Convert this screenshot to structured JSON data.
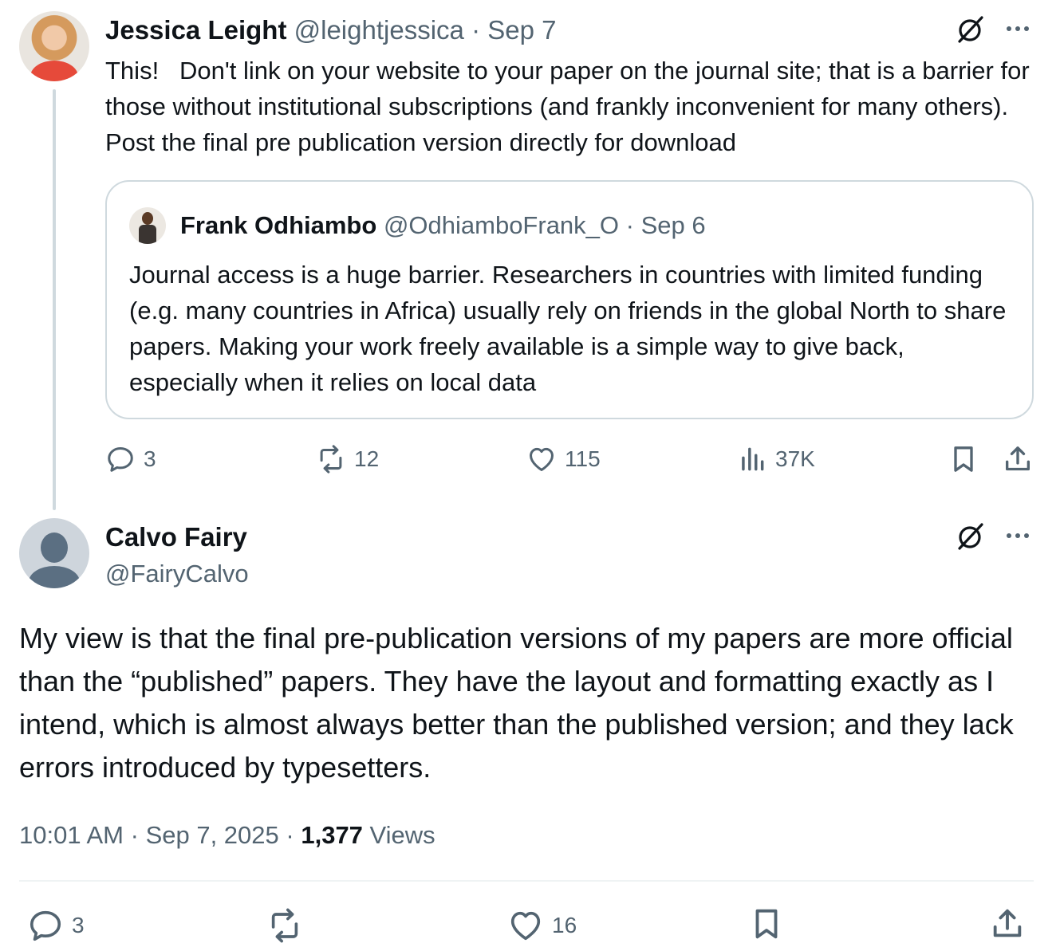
{
  "parent_tweet": {
    "author_name": "Jessica Leight",
    "author_handle": "@leightjessica",
    "separator": "·",
    "date": "Sep 7",
    "text": "This!   Don't link on your website to your paper on the journal site; that is a barrier for those without institutional subscriptions (and frankly inconvenient for many others).  Post the final pre publication version directly for download",
    "quote": {
      "author_name": "Frank Odhiambo",
      "author_handle": "@OdhiamboFrank_O",
      "separator": "·",
      "date": "Sep 6",
      "text": "Journal access is a huge barrier. Researchers in countries with limited funding (e.g. many countries in Africa) usually rely on friends in the global North to share papers. Making your work freely available is a simple way to give back, especially when it relies on local data"
    },
    "actions": {
      "replies": "3",
      "reposts": "12",
      "likes": "115",
      "views": "37K"
    }
  },
  "main_tweet": {
    "author_name": "Calvo Fairy",
    "author_handle": "@FairyCalvo",
    "text": "My view is that the final pre-publication versions of my papers are more official than the “published” papers. They have the layout and formatting exactly as I intend, which is almost always better than the published version; and they lack errors introduced by typesetters.",
    "time": "10:01 AM",
    "date": "Sep 7, 2025",
    "separator": "·",
    "view_count": "1,377",
    "views_label": "Views",
    "actions": {
      "replies": "3",
      "likes": "16"
    }
  },
  "icons": {
    "grok": "grok-slash-icon",
    "more": "more-icon",
    "reply": "reply-icon",
    "repost": "repost-icon",
    "like": "heart-icon",
    "views": "views-icon",
    "bookmark": "bookmark-icon",
    "share": "share-icon"
  },
  "colors": {
    "text": "#0f1419",
    "muted": "#536471",
    "border": "#cfd9de"
  }
}
